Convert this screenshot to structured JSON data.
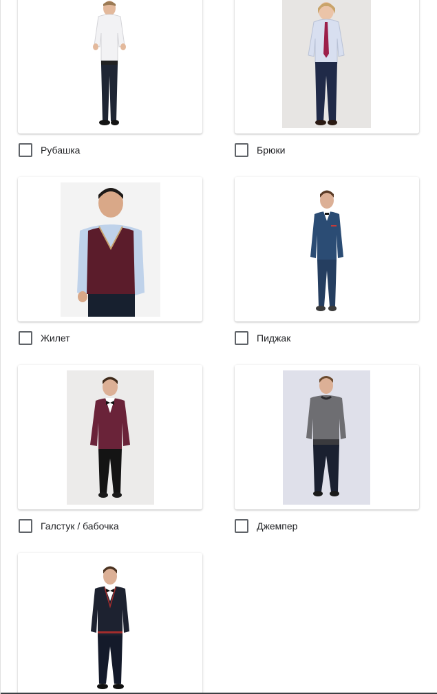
{
  "options": [
    {
      "label": "Рубашка",
      "checked": false
    },
    {
      "label": "Брюки",
      "checked": false
    },
    {
      "label": "Жилет",
      "checked": false
    },
    {
      "label": "Пиджак",
      "checked": false
    },
    {
      "label": "Галстук / бабочка",
      "checked": false
    },
    {
      "label": "Джемпер",
      "checked": false
    }
  ],
  "colors": {
    "checkbox_border": "#5f6368",
    "label_text": "#202124",
    "card_bg": "#ffffff"
  }
}
